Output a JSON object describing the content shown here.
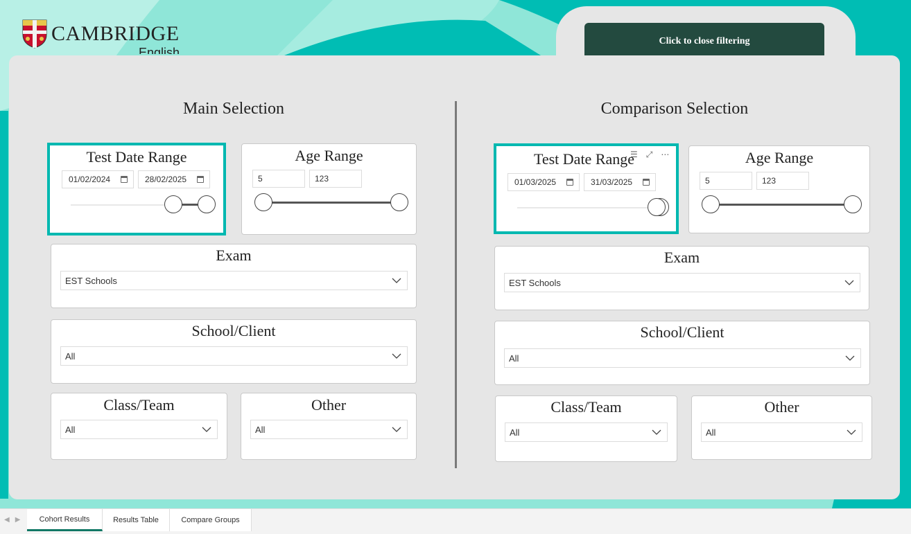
{
  "brand": {
    "name": "CAMBRIDGE",
    "sub": "English"
  },
  "close_button_label": "Click to close filtering",
  "main": {
    "title": "Main Selection",
    "date_range": {
      "title": "Test Date Range",
      "from": "01/02/2024",
      "to": "28/02/2025"
    },
    "age_range": {
      "title": "Age Range",
      "min": "5",
      "max": "123"
    },
    "exam": {
      "title": "Exam",
      "value": "EST Schools"
    },
    "school": {
      "title": "School/Client",
      "value": "All"
    },
    "class_team": {
      "title": "Class/Team",
      "value": "All"
    },
    "other": {
      "title": "Other",
      "value": "All"
    }
  },
  "comparison": {
    "title": "Comparison Selection",
    "date_range": {
      "title": "Test Date Range",
      "from": "01/03/2025",
      "to": "31/03/2025"
    },
    "age_range": {
      "title": "Age Range",
      "min": "5",
      "max": "123"
    },
    "exam": {
      "title": "Exam",
      "value": "EST Schools"
    },
    "school": {
      "title": "School/Client",
      "value": "All"
    },
    "class_team": {
      "title": "Class/Team",
      "value": "All"
    },
    "other": {
      "title": "Other",
      "value": "All"
    }
  },
  "visual_icons": [
    "filter-icon",
    "focus-mode-icon",
    "more-options-icon"
  ],
  "page_tabs": [
    {
      "label": "Cohort Results",
      "active": true
    },
    {
      "label": "Results Table",
      "active": false
    },
    {
      "label": "Compare Groups",
      "active": false
    }
  ],
  "colors": {
    "teal": "#00b8b0",
    "mint": "#8fe6d8",
    "dark_green": "#234a3f",
    "panel": "#e6e6e6"
  }
}
